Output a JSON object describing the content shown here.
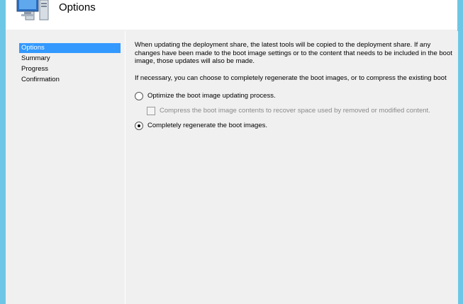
{
  "window": {
    "title": "Options"
  },
  "nav": {
    "items": [
      {
        "label": "Options",
        "selected": true
      },
      {
        "label": "Summary",
        "selected": false
      },
      {
        "label": "Progress",
        "selected": false
      },
      {
        "label": "Confirmation",
        "selected": false
      }
    ]
  },
  "content": {
    "intro": "When updating the deployment share, the latest tools will be copied to the deployment share.  If any changes have been made to the boot image settings or to the content that needs to be included in the boot image, those updates will also be made.",
    "regenerate_note": "If necessary, you can choose to completely regenerate the boot images, or to compress the existing boot",
    "options": {
      "optimize_label": "Optimize the boot image updating process.",
      "optimize_selected": false,
      "compress_label": "Compress the boot image contents to recover space used by removed or modified content.",
      "compress_checked": false,
      "compress_enabled": false,
      "regenerate_label": "Completely regenerate the boot images.",
      "regenerate_selected": true
    }
  },
  "colors": {
    "selection": "#3399ff",
    "desktop_edge": "#6ec6e6",
    "panel_bg": "#f0f0f0"
  },
  "icons": {
    "header": "computer-wizard-icon"
  }
}
